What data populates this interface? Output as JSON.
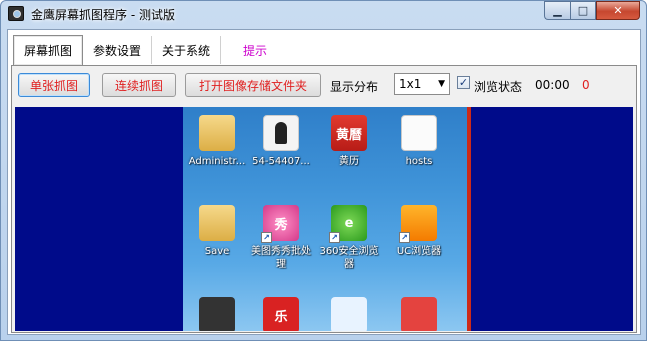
{
  "window": {
    "title": "金鹰屏幕抓图程序 - 测试版",
    "buttons": {
      "minimize": "▁",
      "maximize": "□",
      "close": "✕"
    }
  },
  "tabs": [
    {
      "label": "屏幕抓图",
      "active": true
    },
    {
      "label": "参数设置",
      "active": false
    },
    {
      "label": "关于系统",
      "active": false
    },
    {
      "label": "提示",
      "active": false
    }
  ],
  "toolbar": {
    "single_capture": "单张抓图",
    "continuous_capture": "连续抓图",
    "open_folder": "打开图像存储文件夹",
    "layout_label": "显示分布",
    "layout_value": "1x1",
    "browse_checked": true,
    "browse_label": "浏览状态",
    "timer": "00:00",
    "count": "0",
    "count_color": "#e02020"
  },
  "desktop_icons": [
    {
      "name": "Administr...",
      "icon": "user-folder-icon"
    },
    {
      "name": "54-54407...",
      "icon": "photo-icon"
    },
    {
      "name": "黄历",
      "icon": "calendar-icon",
      "glyph": "黄曆"
    },
    {
      "name": "hosts",
      "icon": "file-icon"
    },
    {
      "name": "Save",
      "icon": "folder-icon"
    },
    {
      "name": "美图秀秀批处理",
      "icon": "meitu-icon",
      "glyph": "秀"
    },
    {
      "name": "360安全浏览器",
      "icon": "360-browser-icon",
      "glyph": "e"
    },
    {
      "name": "UC浏览器",
      "icon": "uc-browser-icon"
    },
    {
      "name": "",
      "icon": "camera-icon"
    },
    {
      "name": "",
      "icon": "red-circle-app-icon",
      "glyph": "乐"
    },
    {
      "name": "",
      "icon": "wing-app-icon"
    },
    {
      "name": "",
      "icon": "red-square-app-icon"
    }
  ]
}
